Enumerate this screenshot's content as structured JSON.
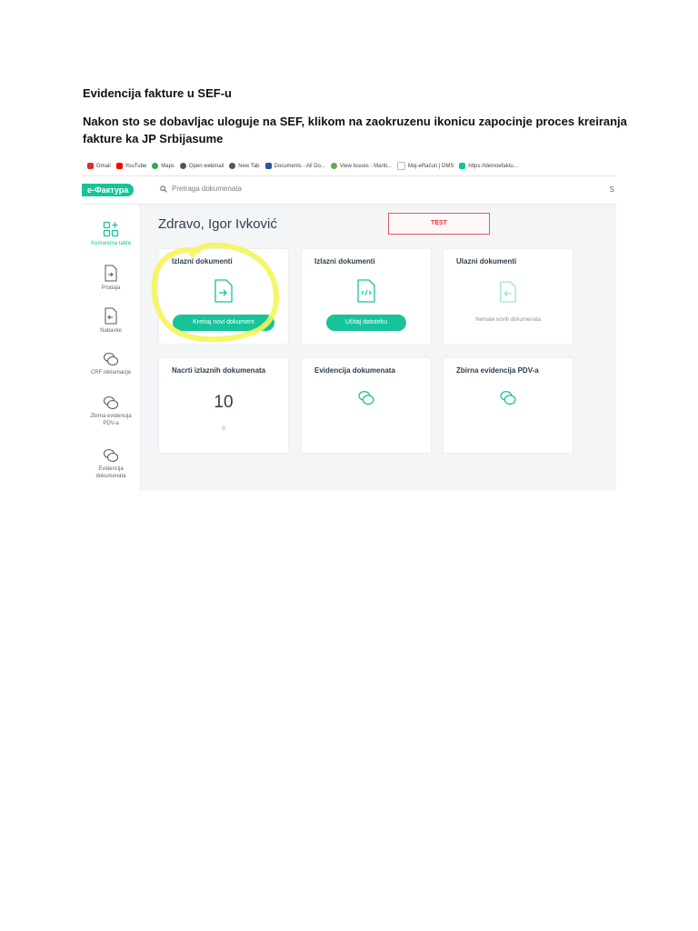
{
  "document": {
    "title": "Evidencija fakture u SEF-u",
    "paragraph": "Nakon sto se dobavljac uloguje na SEF, klikom na zaokruzenu ikonicu zapocinje proces kreiranja fakture ka JP Srbijasume"
  },
  "browser": {
    "bookmarks": [
      {
        "label": "Gmail",
        "icon": "gmail-icon",
        "color": "#d93025"
      },
      {
        "label": "YouTube",
        "icon": "youtube-icon",
        "color": "#ff0000"
      },
      {
        "label": "Maps",
        "icon": "maps-icon",
        "color": "#34a853"
      },
      {
        "label": "Open webmail",
        "icon": "globe-icon",
        "color": "#555555"
      },
      {
        "label": "New Tab",
        "icon": "globe-icon",
        "color": "#555555"
      },
      {
        "label": "Documents - All Do...",
        "icon": "documents-icon",
        "color": "#2b5797"
      },
      {
        "label": "View Issues - Manti...",
        "icon": "bug-icon",
        "color": "#6aa84f"
      },
      {
        "label": "Moj-eRačun | DMS",
        "icon": "page-icon",
        "color": "#bbbbbb"
      },
      {
        "label": "https://demoefaktu...",
        "icon": "site-icon",
        "color": "#17c39b"
      }
    ]
  },
  "app": {
    "logo": "е-Фактура",
    "search_placeholder": "Pretraga dokumenata",
    "search_trailing": "S",
    "greeting": "Zdravo, Igor Ivković",
    "test_badge": "TEST"
  },
  "sidebar": {
    "items": [
      {
        "label": "Komandna tabla",
        "icon": "dashboard-icon"
      },
      {
        "label": "Prodaja",
        "icon": "outgoing-document-icon"
      },
      {
        "label": "Nabavke",
        "icon": "incoming-document-icon"
      },
      {
        "label": "CRF reklamacije",
        "icon": "chat-icon"
      },
      {
        "label": "Zbirna evidencija PDV-a",
        "icon": "chat-icon"
      },
      {
        "label": "Evidencija dokumenata",
        "icon": "chat-icon"
      }
    ]
  },
  "cards": {
    "outgoing_create": {
      "title": "Izlazni dokumenti",
      "button": "Kreiraj novi dokument"
    },
    "outgoing_upload": {
      "title": "Izlazni dokumenti",
      "button": "Učitaj datoteku"
    },
    "incoming": {
      "title": "Ulazni dokumenti",
      "note": "Nemate novih dokumenata"
    },
    "drafts": {
      "title": "Nacrti izlaznih dokumenata",
      "count": "10",
      "subcount": "0"
    },
    "records": {
      "title": "Evidencija dokumenata"
    },
    "vat": {
      "title": "Zbirna evidencija PDV-a"
    }
  },
  "colors": {
    "accent": "#17c39b",
    "test_border": "#e55b5b",
    "highlight": "#f5f55a"
  }
}
